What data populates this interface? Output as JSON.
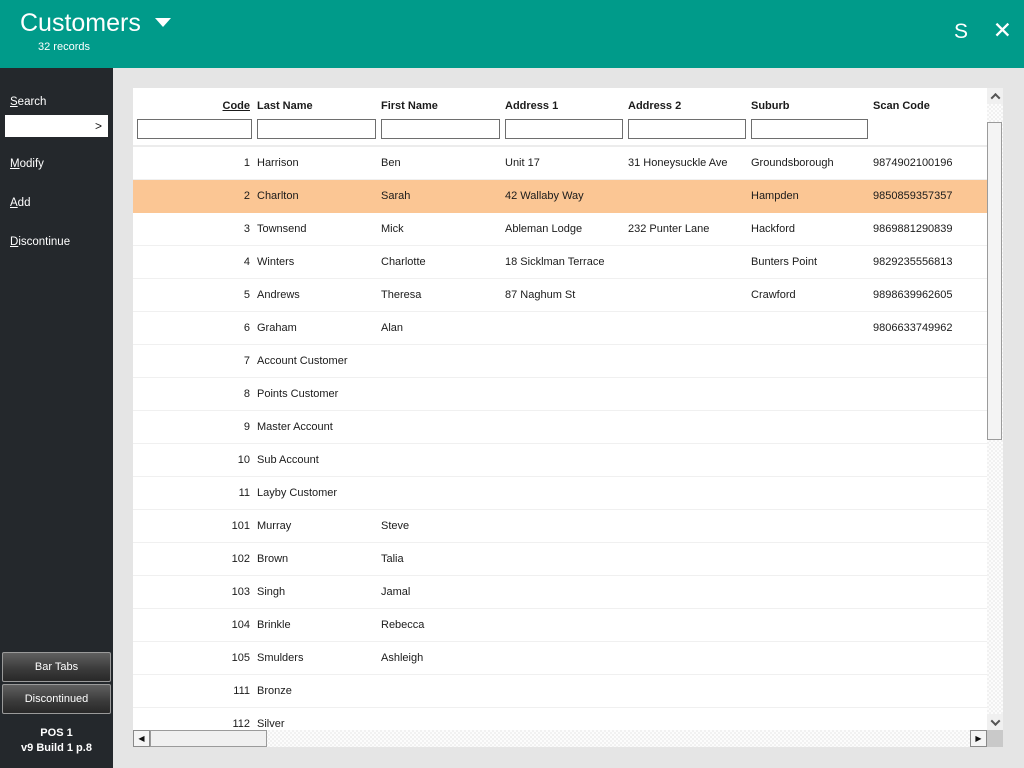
{
  "header": {
    "title": "Customers",
    "records": "32 records",
    "settings_label": "S",
    "close_label": "✕"
  },
  "sidebar": {
    "search_label": "Search",
    "search_value": "",
    "search_go": ">",
    "items": [
      {
        "label": "Modify"
      },
      {
        "label": "Add"
      },
      {
        "label": "Discontinue"
      }
    ],
    "bottom_buttons": [
      {
        "label": "Bar Tabs"
      },
      {
        "label": "Discontinued"
      }
    ],
    "station": "POS 1",
    "version": "v9 Build 1 p.8"
  },
  "table": {
    "columns": [
      {
        "label": "Code",
        "sorted": true,
        "filter": true,
        "align": "right"
      },
      {
        "label": "Last Name",
        "sorted": false,
        "filter": true
      },
      {
        "label": "First Name",
        "sorted": false,
        "filter": true
      },
      {
        "label": "Address 1",
        "sorted": false,
        "filter": true
      },
      {
        "label": "Address 2",
        "sorted": false,
        "filter": true
      },
      {
        "label": "Suburb",
        "sorted": false,
        "filter": true
      },
      {
        "label": "Scan Code",
        "sorted": false,
        "filter": false
      }
    ],
    "rows": [
      {
        "code": "1",
        "last_name": "Harrison",
        "first_name": "Ben",
        "address1": "Unit 17",
        "address2": "31 Honeysuckle Ave",
        "suburb": "Groundsborough",
        "scan_code": "9874902100196",
        "highlighted": false
      },
      {
        "code": "2",
        "last_name": "Charlton",
        "first_name": "Sarah",
        "address1": "42 Wallaby Way",
        "address2": "",
        "suburb": "Hampden",
        "scan_code": "9850859357357",
        "highlighted": true
      },
      {
        "code": "3",
        "last_name": "Townsend",
        "first_name": "Mick",
        "address1": "Ableman Lodge",
        "address2": "232 Punter Lane",
        "suburb": "Hackford",
        "scan_code": "9869881290839",
        "highlighted": false
      },
      {
        "code": "4",
        "last_name": "Winters",
        "first_name": "Charlotte",
        "address1": "18 Sicklman Terrace",
        "address2": "",
        "suburb": "Bunters Point",
        "scan_code": "9829235556813",
        "highlighted": false
      },
      {
        "code": "5",
        "last_name": "Andrews",
        "first_name": "Theresa",
        "address1": "87 Naghum St",
        "address2": "",
        "suburb": "Crawford",
        "scan_code": "9898639962605",
        "highlighted": false
      },
      {
        "code": "6",
        "last_name": "Graham",
        "first_name": "Alan",
        "address1": "",
        "address2": "",
        "suburb": "",
        "scan_code": "9806633749962",
        "highlighted": false
      },
      {
        "code": "7",
        "last_name": "Account Customer",
        "first_name": "",
        "address1": "",
        "address2": "",
        "suburb": "",
        "scan_code": "",
        "highlighted": false
      },
      {
        "code": "8",
        "last_name": "Points Customer",
        "first_name": "",
        "address1": "",
        "address2": "",
        "suburb": "",
        "scan_code": "",
        "highlighted": false
      },
      {
        "code": "9",
        "last_name": "Master Account",
        "first_name": "",
        "address1": "",
        "address2": "",
        "suburb": "",
        "scan_code": "",
        "highlighted": false
      },
      {
        "code": "10",
        "last_name": "Sub Account",
        "first_name": "",
        "address1": "",
        "address2": "",
        "suburb": "",
        "scan_code": "",
        "highlighted": false
      },
      {
        "code": "11",
        "last_name": "Layby Customer",
        "first_name": "",
        "address1": "",
        "address2": "",
        "suburb": "",
        "scan_code": "",
        "highlighted": false
      },
      {
        "code": "101",
        "last_name": "Murray",
        "first_name": "Steve",
        "address1": "",
        "address2": "",
        "suburb": "",
        "scan_code": "",
        "highlighted": false
      },
      {
        "code": "102",
        "last_name": "Brown",
        "first_name": "Talia",
        "address1": "",
        "address2": "",
        "suburb": "",
        "scan_code": "",
        "highlighted": false
      },
      {
        "code": "103",
        "last_name": "Singh",
        "first_name": "Jamal",
        "address1": "",
        "address2": "",
        "suburb": "",
        "scan_code": "",
        "highlighted": false
      },
      {
        "code": "104",
        "last_name": "Brinkle",
        "first_name": "Rebecca",
        "address1": "",
        "address2": "",
        "suburb": "",
        "scan_code": "",
        "highlighted": false
      },
      {
        "code": "105",
        "last_name": "Smulders",
        "first_name": "Ashleigh",
        "address1": "",
        "address2": "",
        "suburb": "",
        "scan_code": "",
        "highlighted": false
      },
      {
        "code": "111",
        "last_name": "Bronze",
        "first_name": "",
        "address1": "",
        "address2": "",
        "suburb": "",
        "scan_code": "",
        "highlighted": false
      },
      {
        "code": "112",
        "last_name": "Silver",
        "first_name": "",
        "address1": "",
        "address2": "",
        "suburb": "",
        "scan_code": "",
        "highlighted": false
      }
    ]
  },
  "colors": {
    "accent_teal": "#009b8a",
    "sidebar_dark": "#24282c",
    "highlight_orange": "#fbc694",
    "background_gray": "#e5e5e5"
  }
}
